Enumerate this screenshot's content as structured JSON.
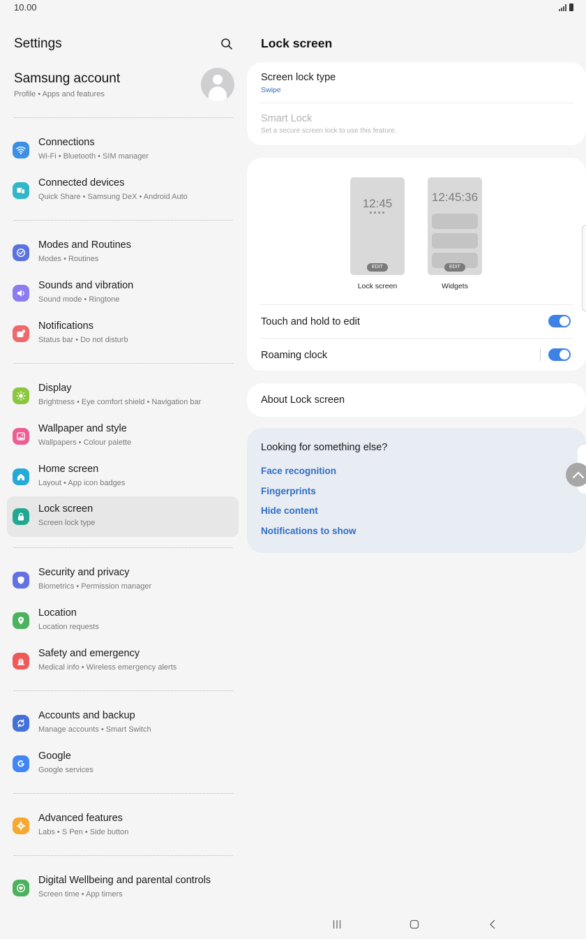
{
  "status_bar": {
    "time": "10.00"
  },
  "left_pane": {
    "title": "Settings",
    "account": {
      "name": "Samsung account",
      "subtitle": "Profile  •  Apps and features"
    },
    "items": [
      {
        "title": "Connections",
        "subtitle": "Wi-Fi  •  Bluetooth  •  SIM manager",
        "icon": "wifi-icon",
        "color": "#3d8fe6"
      },
      {
        "title": "Connected devices",
        "subtitle": "Quick Share  •  Samsung DeX  •  Android Auto",
        "icon": "devices-icon",
        "color": "#2fb8c8"
      },
      {
        "title": "Modes and Routines",
        "subtitle": "Modes  •  Routines",
        "icon": "check-circle-icon",
        "color": "#5b72e0"
      },
      {
        "title": "Sounds and vibration",
        "subtitle": "Sound mode  •  Ringtone",
        "icon": "volume-icon",
        "color": "#8b7cf0"
      },
      {
        "title": "Notifications",
        "subtitle": "Status bar  •  Do not disturb",
        "icon": "notification-icon",
        "color": "#f0686b"
      },
      {
        "title": "Display",
        "subtitle": "Brightness  •  Eye comfort shield  •  Navigation bar",
        "icon": "sun-icon",
        "color": "#8cc63f"
      },
      {
        "title": "Wallpaper and style",
        "subtitle": "Wallpapers  •  Colour palette",
        "icon": "image-icon",
        "color": "#ec5f94"
      },
      {
        "title": "Home screen",
        "subtitle": "Layout  •  App icon badges",
        "icon": "home-icon",
        "color": "#27a9d8"
      },
      {
        "title": "Lock screen",
        "subtitle": "Screen lock type",
        "icon": "lock-icon",
        "color": "#21a893"
      },
      {
        "title": "Security and privacy",
        "subtitle": "Biometrics  •  Permission manager",
        "icon": "shield-icon",
        "color": "#6371e3"
      },
      {
        "title": "Location",
        "subtitle": "Location requests",
        "icon": "location-pin-icon",
        "color": "#4bb35e"
      },
      {
        "title": "Safety and emergency",
        "subtitle": "Medical info  •  Wireless emergency alerts",
        "icon": "alert-icon",
        "color": "#ef5a59"
      },
      {
        "title": "Accounts and backup",
        "subtitle": "Manage accounts  •  Smart Switch",
        "icon": "sync-icon",
        "color": "#4471d8"
      },
      {
        "title": "Google",
        "subtitle": "Google services",
        "icon": "google-icon",
        "color": "#4285f4"
      },
      {
        "title": "Advanced features",
        "subtitle": "Labs  •  S Pen  •  Side button",
        "icon": "gear-icon",
        "color": "#f7a833"
      },
      {
        "title": "Digital Wellbeing and parental controls",
        "subtitle": "Screen time  •  App timers",
        "icon": "heart-icon",
        "color": "#4bb35e"
      }
    ]
  },
  "right_pane": {
    "title": "Lock screen",
    "screen_lock": {
      "title": "Screen lock type",
      "value": "Swipe"
    },
    "smart_lock": {
      "title": "Smart Lock",
      "subtitle": "Set a secure screen lock to use this feature."
    },
    "previews": {
      "lock_time": "12:45",
      "widgets_time": "12:45:36",
      "edit_label": "EDIT",
      "lock_label": "Lock screen",
      "widgets_label": "Widgets"
    },
    "touch_hold": {
      "title": "Touch and hold to edit",
      "on": true
    },
    "roaming_clock": {
      "title": "Roaming clock",
      "on": true
    },
    "about": "About Lock screen",
    "suggestions": {
      "heading": "Looking for something else?",
      "links": [
        "Face recognition",
        "Fingerprints",
        "Hide content",
        "Notifications to show"
      ]
    }
  },
  "colors": {
    "accent": "#3e82e5",
    "link": "#2f6fc5",
    "selected_bg": "#e7e7e7"
  }
}
